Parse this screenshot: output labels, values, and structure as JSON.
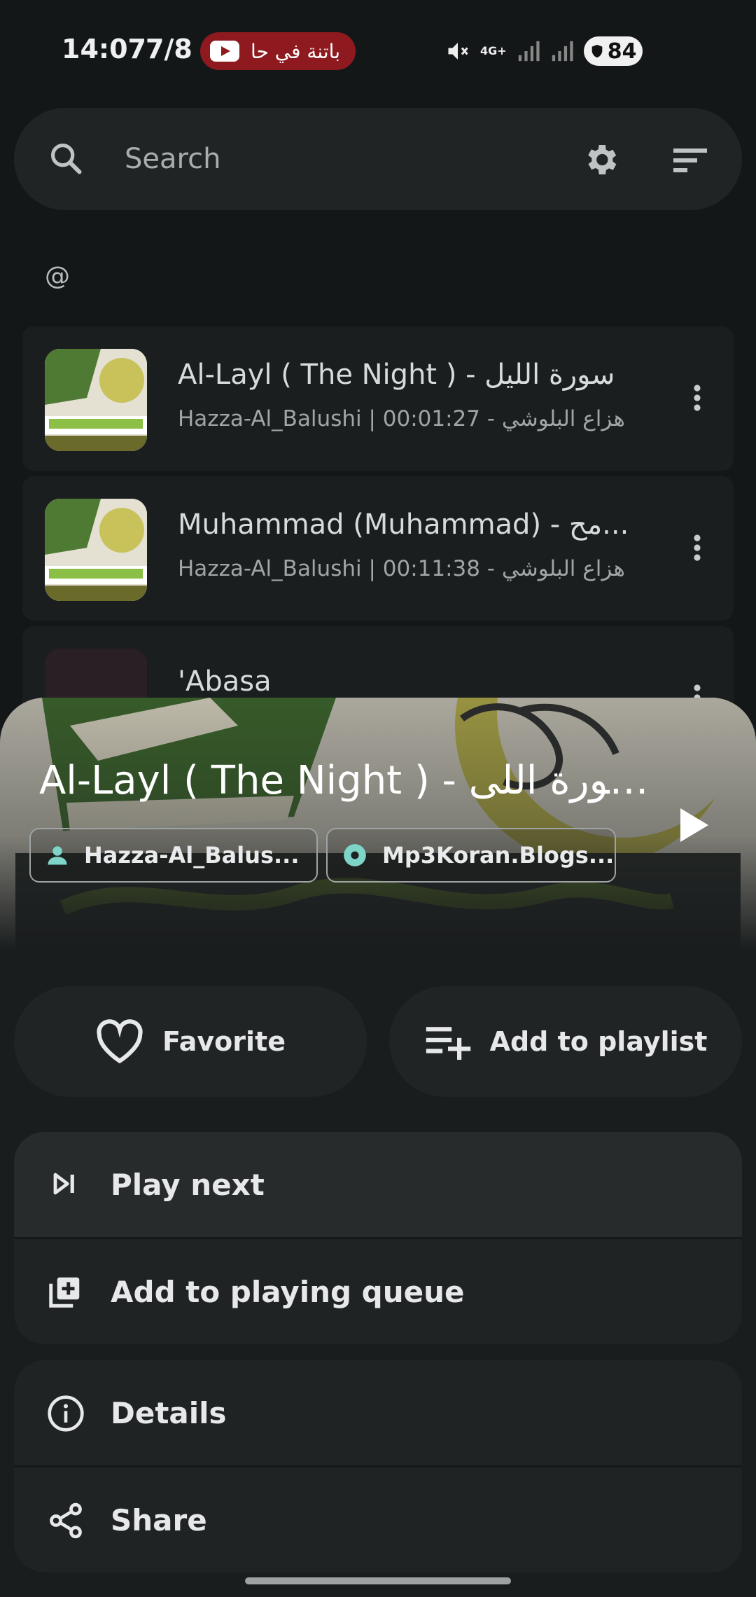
{
  "status_bar": {
    "time": "14:07",
    "date": "7/8",
    "live_badge": "باتنة في حا",
    "network": "4G+",
    "battery": "84"
  },
  "search": {
    "placeholder": "Search"
  },
  "section_label": "@",
  "songs": [
    {
      "title": "Al-Layl ( The Night ) - سورة الليل",
      "subtitle": "Hazza-Al_Balushi | 00:01:27 - هزاع البلوشي"
    },
    {
      "title": "Muhammad (Muhammad) - مح...",
      "subtitle": "Hazza-Al_Balushi | 00:11:38 - هزاع البلوشي"
    },
    {
      "title": "'Abasa",
      "subtitle": ""
    }
  ],
  "sheet": {
    "title": "Al-Layl ( The Night ) - سورة اللى...",
    "artist_chip": "Hazza-Al_Balus...",
    "album_chip": "Mp3Koran.Blogs...",
    "favorite_label": "Favorite",
    "add_to_playlist_label": "Add to playlist",
    "menu": {
      "play_next": "Play next",
      "add_to_queue": "Add to playing queue",
      "details": "Details",
      "share": "Share"
    }
  },
  "colors": {
    "background": "#141718",
    "surface": "#202425",
    "accent_teal": "#7fd4c8",
    "live_badge": "#8e1a1f"
  }
}
